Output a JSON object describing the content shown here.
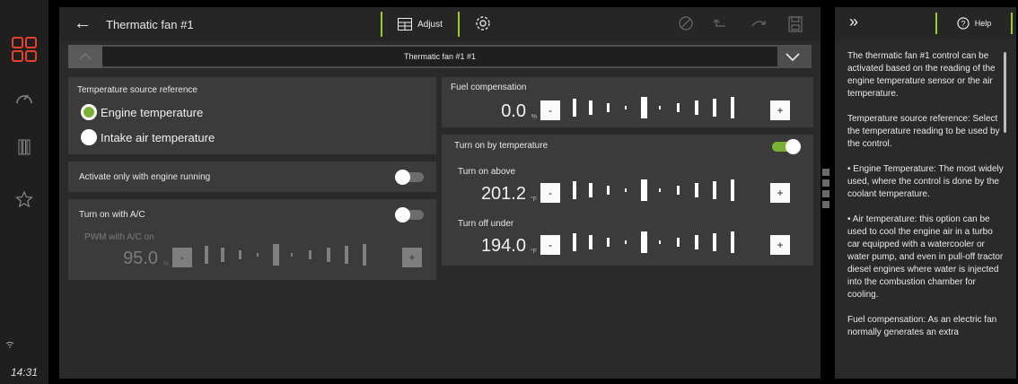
{
  "colors": {
    "accent": "#79b133",
    "highlight": "#9ecb2f",
    "logo": "#e8402a"
  },
  "rail": {
    "clock": "14:31",
    "icons": [
      "apps-grid-icon",
      "gauge-icon",
      "columns-icon",
      "star-icon"
    ]
  },
  "header": {
    "title": "Thermatic fan #1",
    "adjust_label": "Adjust"
  },
  "selector": {
    "value": "Thermatic fan #1 #1"
  },
  "temp_source": {
    "title": "Temperature source reference",
    "options": [
      {
        "label": "Engine temperature",
        "selected": true
      },
      {
        "label": "Intake air temperature",
        "selected": false
      }
    ]
  },
  "engine_running": {
    "label": "Activate only with engine running",
    "enabled": false
  },
  "ac": {
    "label": "Turn on with A/C",
    "enabled": false,
    "pwm_label": "PWM with A/C on",
    "pwm_value": "95.0",
    "pwm_unit": "%"
  },
  "fuel": {
    "title": "Fuel compensation",
    "value": "0.0",
    "unit": "%"
  },
  "turn_on": {
    "title": "Turn on by temperature",
    "enabled": true,
    "above_label": "Turn on above",
    "above_value": "201.2",
    "above_unit": "°F",
    "below_label": "Turn off under",
    "below_value": "194.0",
    "below_unit": "°F"
  },
  "controls": {
    "minus": "-",
    "plus": "+"
  },
  "help": {
    "button_label": "Help",
    "text": "The thermatic fan #1 control can be activated based on the reading of the engine temperature sensor or the air temperature.\n\nTemperature source reference: Select the temperature reading to be used by the control.\n\n• Engine Temperature: The most widely used, where the control is done by the coolant temperature.\n\n• Air temperature: this option can be used to cool the engine air in a turbo car equipped with a watercooler or water pump, and even in pull-off tractor diesel engines where water is injected into the combustion chamber for cooling.\n\nFuel compensation: As an electric fan normally generates an extra"
  }
}
